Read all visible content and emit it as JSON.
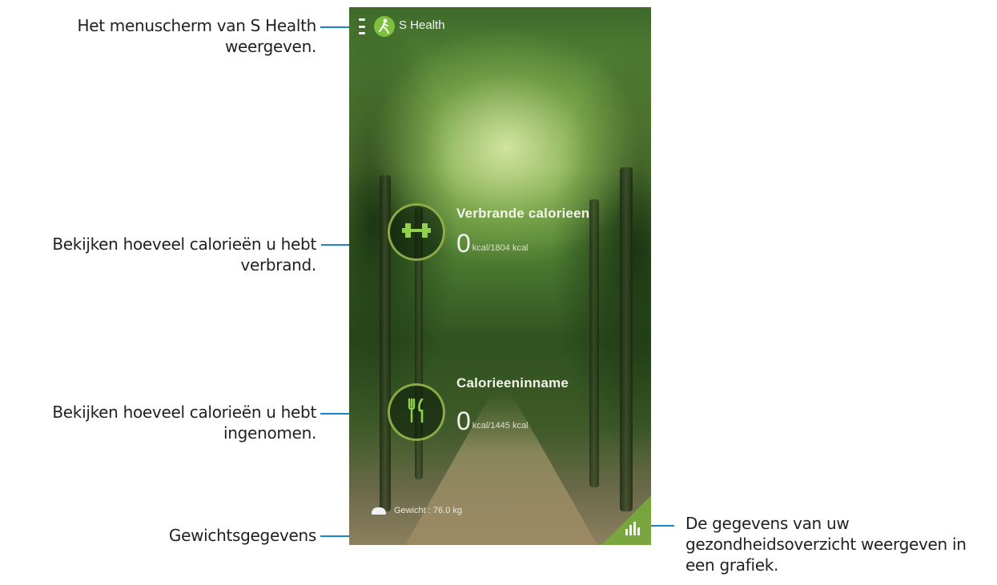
{
  "app": {
    "title": "S Health",
    "icons": {
      "menu": "menu-icon",
      "logo": "walking-person-icon",
      "burned": "dumbbell-icon",
      "intake": "fork-knife-icon",
      "weight": "scale-icon",
      "graph": "bar-chart-icon"
    },
    "colors": {
      "accent": "#7cc23e",
      "callout_line": "#1a84c7"
    }
  },
  "screen": {
    "burned": {
      "label": "Verbrande calorieen",
      "value": "0",
      "unit": "kcal/1804 kcal"
    },
    "intake": {
      "label": "Calorieeninname",
      "value": "0",
      "unit": "kcal/1445 kcal"
    },
    "weight": {
      "text": "Gewicht : 76.0 kg"
    }
  },
  "callouts": {
    "menu": "Het menuscherm van S Health weergeven.",
    "burned": "Bekijken hoeveel calorieën u hebt verbrand.",
    "intake": "Bekijken hoeveel calorieën u hebt ingenomen.",
    "weight": "Gewichtsgegevens",
    "graph": "De gegevens van uw gezondheidsoverzicht weergeven in een grafiek."
  }
}
